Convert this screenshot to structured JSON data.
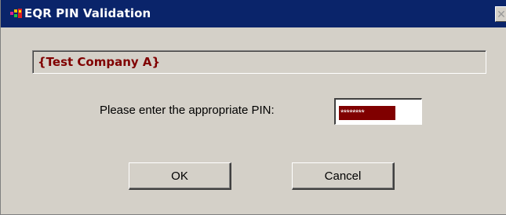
{
  "window": {
    "title": "EQR PIN Validation",
    "close_glyph": "✕",
    "icon": "app-icon"
  },
  "company": {
    "name": "{Test Company A}"
  },
  "pin": {
    "label": "Please enter the appropriate PIN:",
    "masked_value": "********"
  },
  "buttons": {
    "ok_label": "OK",
    "cancel_label": "Cancel"
  },
  "colors": {
    "titlebar": "#0a246a",
    "dialog_bg": "#d4d0c8",
    "company_text": "#800000",
    "selection": "#800000"
  }
}
